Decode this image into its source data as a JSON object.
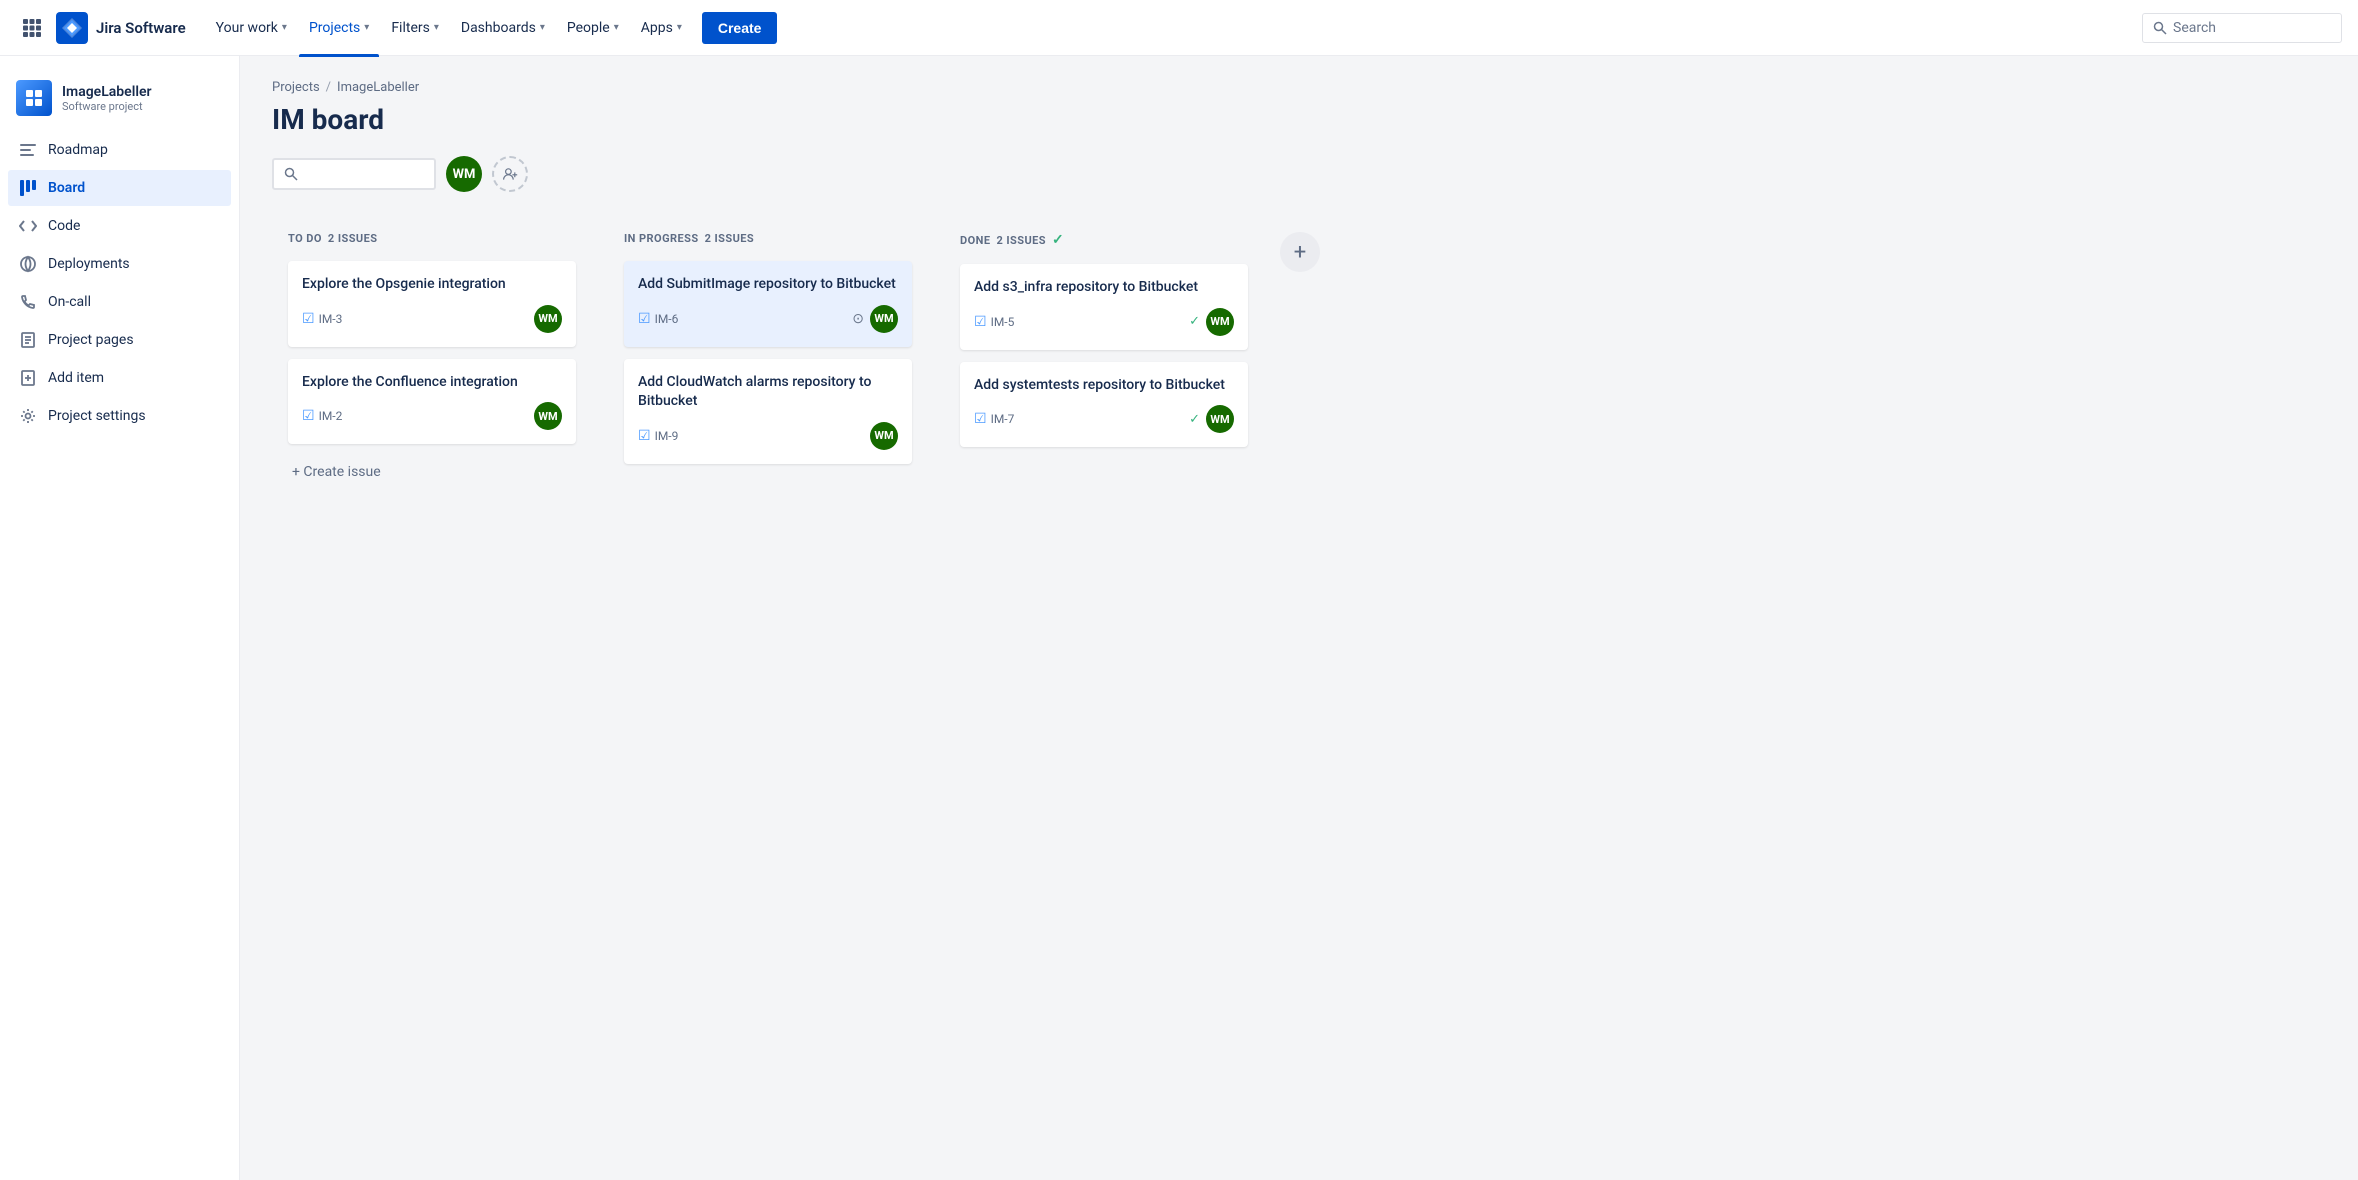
{
  "topnav": {
    "logo_text": "Jira Software",
    "nav_items": [
      {
        "label": "Your work",
        "chevron": true,
        "active": false
      },
      {
        "label": "Projects",
        "chevron": true,
        "active": true
      },
      {
        "label": "Filters",
        "chevron": true,
        "active": false
      },
      {
        "label": "Dashboards",
        "chevron": true,
        "active": false
      },
      {
        "label": "People",
        "chevron": true,
        "active": false
      },
      {
        "label": "Apps",
        "chevron": true,
        "active": false
      }
    ],
    "create_label": "Create",
    "search_placeholder": "Search"
  },
  "sidebar": {
    "project_name": "ImageLabeller",
    "project_type": "Software project",
    "nav_items": [
      {
        "id": "roadmap",
        "label": "Roadmap",
        "active": false
      },
      {
        "id": "board",
        "label": "Board",
        "active": true
      },
      {
        "id": "code",
        "label": "Code",
        "active": false
      },
      {
        "id": "deployments",
        "label": "Deployments",
        "active": false
      },
      {
        "id": "oncall",
        "label": "On-call",
        "active": false
      },
      {
        "id": "project-pages",
        "label": "Project pages",
        "active": false
      },
      {
        "id": "add-item",
        "label": "Add item",
        "active": false
      },
      {
        "id": "project-settings",
        "label": "Project settings",
        "active": false
      }
    ]
  },
  "breadcrumb": {
    "projects_label": "Projects",
    "separator": "/",
    "current": "ImageLabeller"
  },
  "page": {
    "title": "IM board"
  },
  "toolbar": {
    "avatar_initials": "WM",
    "add_member_icon": "+"
  },
  "columns": [
    {
      "id": "todo",
      "title": "TO DO",
      "count": "2 ISSUES",
      "done_marker": false,
      "cards": [
        {
          "id": "card-im3",
          "title": "Explore the Opsgenie integration",
          "issue_id": "IM-3",
          "highlighted": false,
          "show_pin": false,
          "show_check": false,
          "avatar_initials": "WM"
        },
        {
          "id": "card-im2",
          "title": "Explore the Confluence integration",
          "issue_id": "IM-2",
          "highlighted": false,
          "show_pin": false,
          "show_check": false,
          "avatar_initials": "WM"
        }
      ],
      "create_issue_label": "+ Create issue"
    },
    {
      "id": "inprogress",
      "title": "IN PROGRESS",
      "count": "2 ISSUES",
      "done_marker": false,
      "cards": [
        {
          "id": "card-im6",
          "title": "Add SubmitImage repository to Bitbucket",
          "issue_id": "IM-6",
          "highlighted": true,
          "show_pin": true,
          "show_check": false,
          "avatar_initials": "WM"
        },
        {
          "id": "card-im9",
          "title": "Add CloudWatch alarms repository to Bitbucket",
          "issue_id": "IM-9",
          "highlighted": false,
          "show_pin": false,
          "show_check": false,
          "avatar_initials": "WM"
        }
      ],
      "create_issue_label": null
    },
    {
      "id": "done",
      "title": "DONE",
      "count": "2 ISSUES",
      "done_marker": true,
      "cards": [
        {
          "id": "card-im5",
          "title": "Add s3_infra repository to Bitbucket",
          "issue_id": "IM-5",
          "highlighted": false,
          "show_pin": false,
          "show_check": true,
          "avatar_initials": "WM"
        },
        {
          "id": "card-im7",
          "title": "Add systemtests repository to Bitbucket",
          "issue_id": "IM-7",
          "highlighted": false,
          "show_pin": false,
          "show_check": true,
          "avatar_initials": "WM"
        }
      ],
      "create_issue_label": null
    }
  ],
  "colors": {
    "accent": "#0052cc",
    "avatar_bg": "#166a00",
    "done_color": "#36b37e"
  }
}
